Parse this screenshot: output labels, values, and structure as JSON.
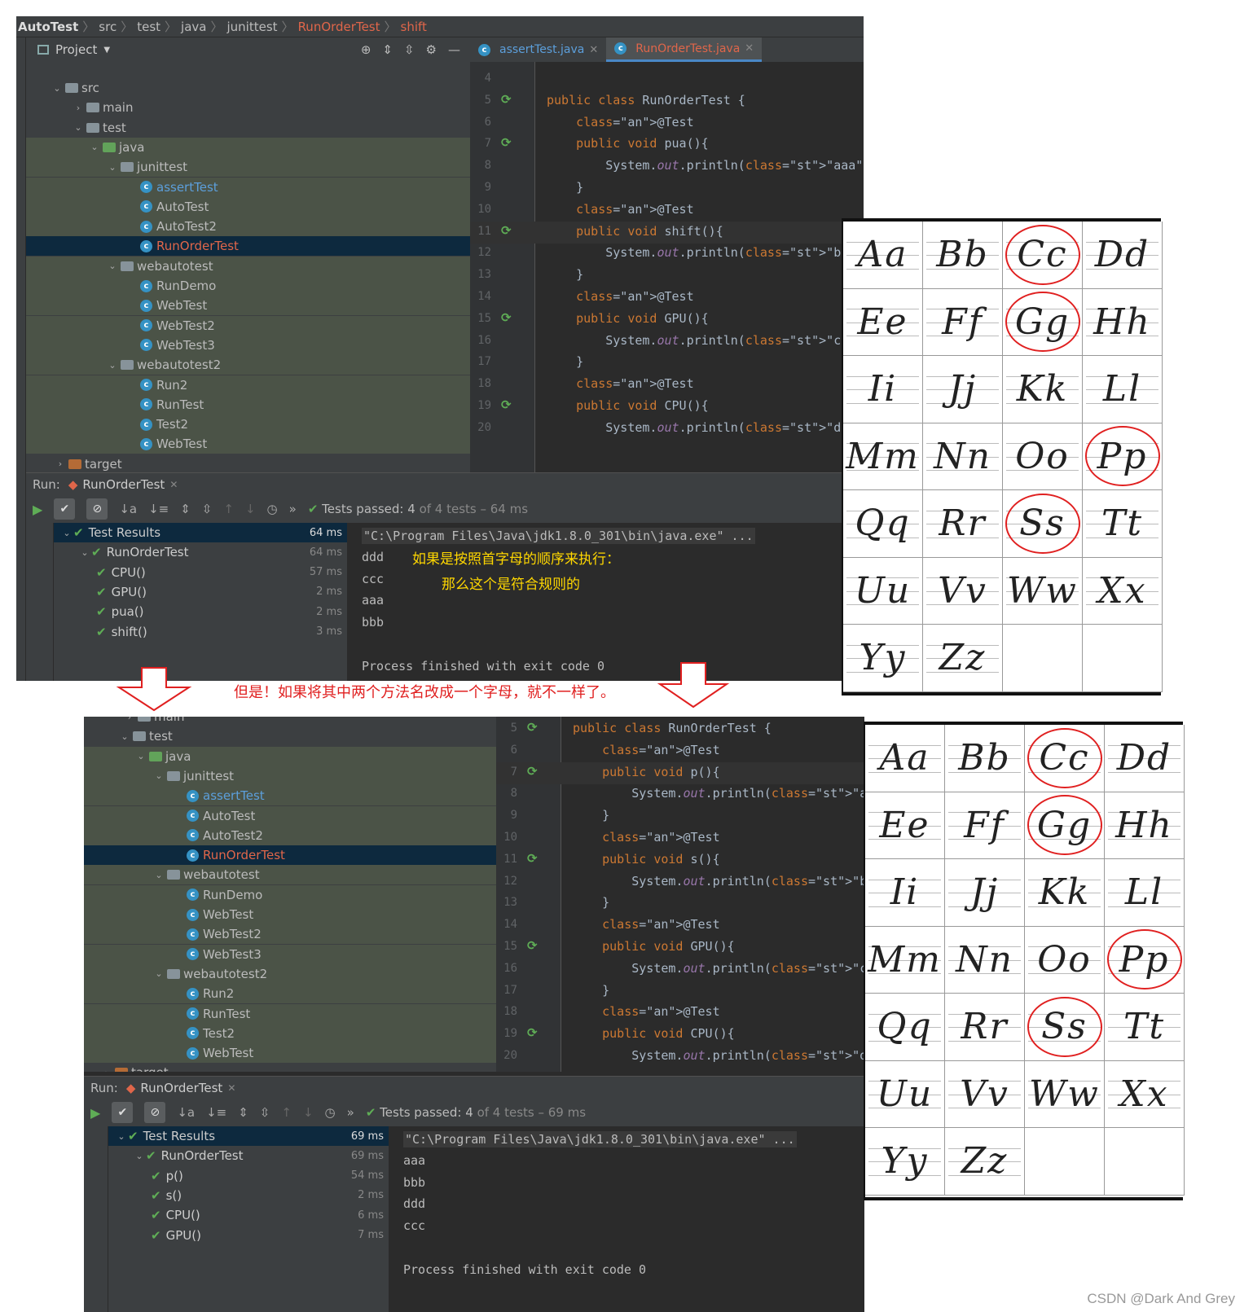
{
  "top": {
    "breadcrumb": [
      "AutoTest",
      "src",
      "test",
      "java",
      "junittest",
      "RunOrderTest",
      "shift"
    ],
    "project_label": "Project",
    "tree": [
      {
        "label": "src",
        "kind": "folder",
        "arrow": "⌄"
      },
      {
        "label": "main",
        "kind": "folder",
        "arrow": "›"
      },
      {
        "label": "test",
        "kind": "folder",
        "arrow": "⌄"
      },
      {
        "label": "java",
        "kind": "folder-green",
        "arrow": "⌄"
      },
      {
        "label": "junittest",
        "kind": "package",
        "arrow": "⌄"
      },
      {
        "label": "assertTest",
        "kind": "class",
        "color": "blue"
      },
      {
        "label": "AutoTest",
        "kind": "class"
      },
      {
        "label": "AutoTest2",
        "kind": "class"
      },
      {
        "label": "RunOrderTest",
        "kind": "class",
        "color": "red"
      },
      {
        "label": "webautotest",
        "kind": "package",
        "arrow": "⌄"
      },
      {
        "label": "RunDemo",
        "kind": "class"
      },
      {
        "label": "WebTest",
        "kind": "class"
      },
      {
        "label": "WebTest2",
        "kind": "class"
      },
      {
        "label": "WebTest3",
        "kind": "class"
      },
      {
        "label": "webautotest2",
        "kind": "package",
        "arrow": "⌄"
      },
      {
        "label": "Run2",
        "kind": "class"
      },
      {
        "label": "RunTest",
        "kind": "class"
      },
      {
        "label": "Test2",
        "kind": "class"
      },
      {
        "label": "WebTest",
        "kind": "class"
      },
      {
        "label": "target",
        "kind": "folder-orange",
        "arrow": "›"
      }
    ],
    "tabs": [
      {
        "label": "assertTest.java"
      },
      {
        "label": "RunOrderTest.java"
      }
    ],
    "code": [
      {
        "n": "4",
        "text": ""
      },
      {
        "n": "5",
        "text": "public class RunOrderTest {"
      },
      {
        "n": "6",
        "text": "    @Test"
      },
      {
        "n": "7",
        "text": "    public void pua(){"
      },
      {
        "n": "8",
        "text": "        System.out.println(\"aaa\");"
      },
      {
        "n": "9",
        "text": "    }"
      },
      {
        "n": "10",
        "text": "    @Test"
      },
      {
        "n": "11",
        "text": "    public void shift(){"
      },
      {
        "n": "12",
        "text": "        System.out.println(\"bbb\");"
      },
      {
        "n": "13",
        "text": "    }"
      },
      {
        "n": "14",
        "text": "    @Test"
      },
      {
        "n": "15",
        "text": "    public void GPU(){"
      },
      {
        "n": "16",
        "text": "        System.out.println(\"ccc\");"
      },
      {
        "n": "17",
        "text": "    }"
      },
      {
        "n": "18",
        "text": "    @Test"
      },
      {
        "n": "19",
        "text": "    public void CPU(){"
      },
      {
        "n": "20",
        "text": "        System.out.println(\"ddd\");"
      }
    ],
    "run_label": "Run:",
    "run_tab": "RunOrderTest",
    "pass_prefix": "Tests passed:",
    "pass_count": "4",
    "pass_suffix": "of 4 tests – 64 ms",
    "results": [
      {
        "label": "Test Results",
        "ms": "64 ms"
      },
      {
        "label": "RunOrderTest",
        "ms": "64 ms"
      },
      {
        "label": "CPU()",
        "ms": "57 ms"
      },
      {
        "label": "GPU()",
        "ms": "2 ms"
      },
      {
        "label": "pua()",
        "ms": "2 ms"
      },
      {
        "label": "shift()",
        "ms": "3 ms"
      }
    ],
    "console": [
      "\"C:\\Program Files\\Java\\jdk1.8.0_301\\bin\\java.exe\" ...",
      "ddd",
      "ccc",
      "aaa",
      "bbb",
      "",
      "Process finished with exit code 0"
    ],
    "note1": "如果是按照首字母的顺序来执行：",
    "note2": "那么这个是符合规则的"
  },
  "middle_text": "但是！如果将其中两个方法名改成一个字母，就不一样了。",
  "bottom": {
    "tree": [
      {
        "label": "main",
        "kind": "folder",
        "arrow": "›"
      },
      {
        "label": "test",
        "kind": "folder",
        "arrow": "⌄"
      },
      {
        "label": "java",
        "kind": "folder-green",
        "arrow": "⌄"
      },
      {
        "label": "junittest",
        "kind": "package",
        "arrow": "⌄"
      },
      {
        "label": "assertTest",
        "kind": "class",
        "color": "blue"
      },
      {
        "label": "AutoTest",
        "kind": "class"
      },
      {
        "label": "AutoTest2",
        "kind": "class"
      },
      {
        "label": "RunOrderTest",
        "kind": "class",
        "color": "red"
      },
      {
        "label": "webautotest",
        "kind": "package",
        "arrow": "⌄"
      },
      {
        "label": "RunDemo",
        "kind": "class"
      },
      {
        "label": "WebTest",
        "kind": "class"
      },
      {
        "label": "WebTest2",
        "kind": "class"
      },
      {
        "label": "WebTest3",
        "kind": "class"
      },
      {
        "label": "webautotest2",
        "kind": "package",
        "arrow": "⌄"
      },
      {
        "label": "Run2",
        "kind": "class"
      },
      {
        "label": "RunTest",
        "kind": "class"
      },
      {
        "label": "Test2",
        "kind": "class"
      },
      {
        "label": "WebTest",
        "kind": "class"
      },
      {
        "label": "target",
        "kind": "folder-orange",
        "arrow": "›"
      }
    ],
    "code": [
      {
        "n": "5",
        "text": "public class RunOrderTest {"
      },
      {
        "n": "6",
        "text": "    @Test"
      },
      {
        "n": "7",
        "text": "    public void p(){"
      },
      {
        "n": "8",
        "text": "        System.out.println(\"aaa\");"
      },
      {
        "n": "9",
        "text": "    }"
      },
      {
        "n": "10",
        "text": "    @Test"
      },
      {
        "n": "11",
        "text": "    public void s(){"
      },
      {
        "n": "12",
        "text": "        System.out.println(\"bbb\");"
      },
      {
        "n": "13",
        "text": "    }"
      },
      {
        "n": "14",
        "text": "    @Test"
      },
      {
        "n": "15",
        "text": "    public void GPU(){"
      },
      {
        "n": "16",
        "text": "        System.out.println(\"ccc\");"
      },
      {
        "n": "17",
        "text": "    }"
      },
      {
        "n": "18",
        "text": "    @Test"
      },
      {
        "n": "19",
        "text": "    public void CPU(){"
      },
      {
        "n": "20",
        "text": "        System.out.println(\"ddd\");"
      }
    ],
    "run_label": "Run:",
    "run_tab": "RunOrderTest",
    "pass_prefix": "Tests passed:",
    "pass_count": "4",
    "pass_suffix": "of 4 tests – 69 ms",
    "results": [
      {
        "label": "Test Results",
        "ms": "69 ms"
      },
      {
        "label": "RunOrderTest",
        "ms": "69 ms"
      },
      {
        "label": "p()",
        "ms": "54 ms"
      },
      {
        "label": "s()",
        "ms": "2 ms"
      },
      {
        "label": "CPU()",
        "ms": "6 ms"
      },
      {
        "label": "GPU()",
        "ms": "7 ms"
      }
    ],
    "console": [
      "\"C:\\Program Files\\Java\\jdk1.8.0_301\\bin\\java.exe\" ...",
      "aaa",
      "bbb",
      "ddd",
      "ccc",
      "",
      "Process finished with exit code 0"
    ]
  },
  "alphabet": [
    "Aa",
    "Bb",
    "Cc",
    "Dd",
    "Ee",
    "Ff",
    "Gg",
    "Hh",
    "Ii",
    "Jj",
    "Kk",
    "Ll",
    "Mm",
    "Nn",
    "Oo",
    "Pp",
    "Qq",
    "Rr",
    "Ss",
    "Tt",
    "Uu",
    "Vv",
    "Ww",
    "Xx",
    "Yy",
    "Zz"
  ],
  "circled": [
    "Cc",
    "Gg",
    "Pp",
    "Ss"
  ],
  "watermark": "CSDN @Dark And Grey"
}
